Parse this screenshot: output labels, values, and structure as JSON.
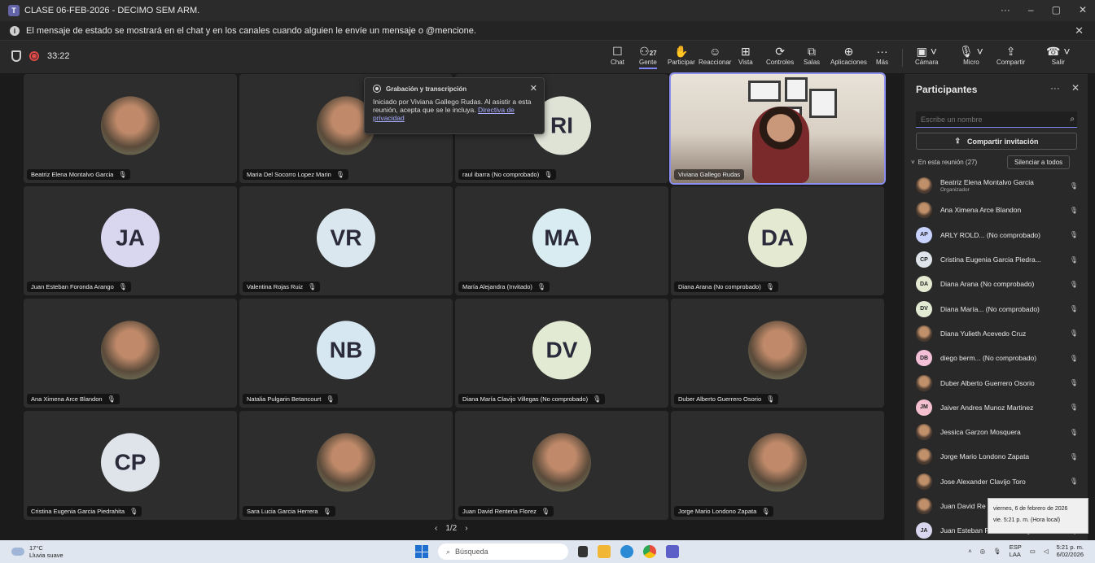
{
  "window": {
    "title": "CLASE 06-FEB-2026 - DECIMO SEM ARM."
  },
  "banner": {
    "text": "El mensaje de estado se mostrará en el chat y en los canales cuando alguien le envíe un mensaje o @mencione."
  },
  "toolbar": {
    "timer": "33:22",
    "chat": "Chat",
    "people": "Gente",
    "people_count": "27",
    "raise": "Participar",
    "react": "Reaccionar",
    "view": "Vista",
    "controls": "Controles",
    "rooms": "Salas",
    "apps": "Aplicaciones",
    "more": "Más",
    "camera": "Cámara",
    "mic": "Micro",
    "share": "Compartir",
    "leave": "Salir"
  },
  "toast": {
    "title": "Grabación y transcripción",
    "body": "Iniciado por Viviana Gallego Rudas. Al asistir a esta reunión, acepta que se le incluya.",
    "link": "Directiva de privacidad"
  },
  "tiles": [
    {
      "name": "Beatriz Elena Montalvo Garcia",
      "initials": "",
      "color": "#c9a088"
    },
    {
      "name": "Maria Del Socorro Lopez Marin",
      "initials": "",
      "color": "#b08a70"
    },
    {
      "name": "raul ibarra (No comprobado)",
      "initials": "RI",
      "color": "#dfe3d6"
    },
    {
      "name": "Viviana Gallego Rudas",
      "initials": "",
      "color": ""
    },
    {
      "name": "Juan Esteban Foronda Arango",
      "initials": "JA",
      "color": "#d9d6ef"
    },
    {
      "name": "Valentina Rojas Ruiz",
      "initials": "VR",
      "color": "#dbe7ee"
    },
    {
      "name": "María Alejandra (Invitado)",
      "initials": "MA",
      "color": "#d9ecf2"
    },
    {
      "name": "Diana Arana (No comprobado)",
      "initials": "DA",
      "color": "#e4ead2"
    },
    {
      "name": "Ana Ximena Arce Blandon",
      "initials": "",
      "color": "#d0a090"
    },
    {
      "name": "Natalia Pulgarin Betancourt",
      "initials": "NB",
      "color": "#d6e7f2"
    },
    {
      "name": "Diana María Clavijo Villegas (No comprobado)",
      "initials": "DV",
      "color": "#e3ead3"
    },
    {
      "name": "Duber Alberto Guerrero Osorio",
      "initials": "",
      "color": "#b09070"
    },
    {
      "name": "Cristina Eugenia Garcia Piedrahita",
      "initials": "CP",
      "color": "#dfe4ea"
    },
    {
      "name": "Sara Lucia Garcia Herrera",
      "initials": "",
      "color": "#a08070"
    },
    {
      "name": "Juan David Renteria Florez",
      "initials": "",
      "color": "#8a8a70"
    },
    {
      "name": "Jorge Mario Londono Zapata",
      "initials": "",
      "color": "#a09080"
    }
  ],
  "pager": {
    "label": "1/2"
  },
  "panel": {
    "title": "Participantes",
    "search_placeholder": "Escribe un nombre",
    "invite": "Compartir invitación",
    "in_meeting": "En esta reunión (27)",
    "mute_all": "Silenciar a todos",
    "participants": [
      {
        "name": "Beatriz Elena Montalvo Garcia",
        "sub": "Organizador",
        "initials": "",
        "color": ""
      },
      {
        "name": "Ana Ximena Arce Blandon",
        "sub": "",
        "initials": "",
        "color": ""
      },
      {
        "name": "ARLY ROLD... (No comprobado)",
        "sub": "",
        "initials": "AP",
        "color": "#c9d3ff"
      },
      {
        "name": "Cristina Eugenia Garcia Piedra...",
        "sub": "",
        "initials": "CP",
        "color": "#dfe4ea"
      },
      {
        "name": "Diana Arana (No comprobado)",
        "sub": "",
        "initials": "DA",
        "color": "#e4ead2"
      },
      {
        "name": "Diana María... (No comprobado)",
        "sub": "",
        "initials": "DV",
        "color": "#e3ead3"
      },
      {
        "name": "Diana Yulieth Acevedo Cruz",
        "sub": "",
        "initials": "",
        "color": ""
      },
      {
        "name": "diego berm... (No comprobado)",
        "sub": "",
        "initials": "DB",
        "color": "#f4c0d8"
      },
      {
        "name": "Duber Alberto Guerrero Osorio",
        "sub": "",
        "initials": "",
        "color": ""
      },
      {
        "name": "Jaiver Andres Munoz Martinez",
        "sub": "",
        "initials": "JM",
        "color": "#f4c0d0"
      },
      {
        "name": "Jessica Garzon Mosquera",
        "sub": "",
        "initials": "",
        "color": ""
      },
      {
        "name": "Jorge Mario Londono Zapata",
        "sub": "",
        "initials": "",
        "color": ""
      },
      {
        "name": "Jose Alexander Clavijo Toro",
        "sub": "",
        "initials": "",
        "color": ""
      },
      {
        "name": "Juan David Re",
        "sub": "",
        "initials": "",
        "color": ""
      },
      {
        "name": "Juan Esteban Foronda Arango",
        "sub": "",
        "initials": "JA",
        "color": "#d9d6ef"
      }
    ]
  },
  "tooltip": {
    "line1": "viernes, 6 de febrero de 2026",
    "line2": "vie. 5:21 p. m. (Hora local)"
  },
  "taskbar": {
    "temp": "17°C",
    "weather": "Lluvia suave",
    "search": "Búsqueda",
    "lang1": "ESP",
    "lang2": "LAA",
    "time": "5:21 p. m.",
    "date": "6/02/2026"
  }
}
